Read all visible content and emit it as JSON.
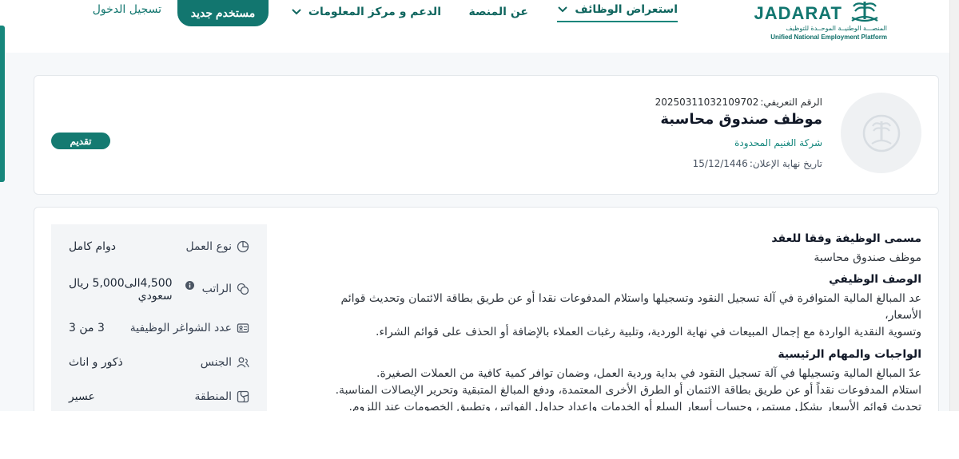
{
  "header": {
    "logo_word": "JADARAT",
    "logo_ar": "المنصـــة الوطنيــة الموحــدة للتوظيف",
    "logo_en": "Unified National Employment Platform",
    "nav": {
      "jobs": "استعراض الوظائف",
      "about": "عن المنصة",
      "support": "الدعم و مركز المعلومات"
    },
    "new_user": "مستخدم جديد",
    "login": "تسجيل الدخول"
  },
  "job": {
    "ref_label": "الرقم التعريفي:",
    "ref_value": "20250311032109702",
    "title": "موظف صندوق محاسبة",
    "company": "شركة الغنيم المحدودة",
    "deadline_label": "تاريخ نهاية الإعلان:",
    "deadline_value": "15/12/1446",
    "apply": "تقديم"
  },
  "details": {
    "work_type_label": "نوع العمل",
    "work_type_value": "دوام كامل",
    "salary_label": "الراتب",
    "salary_value_1": "4,500الى5,000 ريال",
    "salary_value_2": "سعودي",
    "vacancies_label": "عدد الشواغر الوظيفية",
    "vacancies_value": "3 من 3",
    "gender_label": "الجنس",
    "gender_value": "ذكور و اناث",
    "region_label": "المنطقة",
    "region_value": "عسير"
  },
  "content": {
    "title_heading": "مسمى الوظيفة وفقا للعقد",
    "title_value": "موظف صندوق محاسبة",
    "desc_heading": "الوصف الوظيفي",
    "desc_1": "عد المبالغ المالية المتوافرة في آلة تسجيل النقود وتسجيلها واستلام المدفوعات نقدا أو عن طريق بطاقة الائتمان وتحديث قوائم الأسعار،",
    "desc_2": "وتسوية النقدية الواردة مع إجمال المبيعات في نهاية الوردية، وتلبية رغبات العملاء بالإضافة أو الحذف على قوائم الشراء.",
    "duties_heading": "الواجبات والمهام الرئيسية",
    "duty_1": "عدّ المبالغ المالية وتسجيلها في آلة تسجيل النقود في بداية وردية العمل، وضمان توافر كمية كافية من العملات الصغيرة.",
    "duty_2": "استلام المدفوعات نقداً أو عن طريق بطاقة الائتمان أو الطرق الأخرى المعتمدة، ودفع المبالغ المتبقية وتحرير الإيصالات المناسبة.",
    "duty_3": "تحديث قوائم الأسعار بشكل مستمر، وحساب أسعار السلع أو الخدمات وإعداد جداول الفواتير، وتطبيق الخصومات عند اللزوم."
  },
  "colors": {
    "brand": "#12766f",
    "accent": "#15877d",
    "page_bg": "#f6f8fa"
  },
  "icons": {
    "work_type": "pie-chart-icon",
    "salary": "coins-icon",
    "vacancies": "id-card-icon",
    "gender": "people-icon",
    "region": "map-icon",
    "salary_info": "info-icon",
    "dropdown": "chevron-down-icon"
  }
}
